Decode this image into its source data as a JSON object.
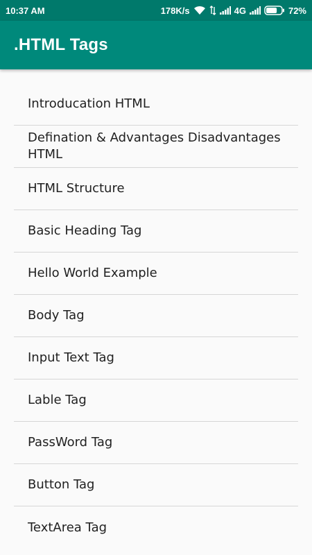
{
  "status_bar": {
    "time": "10:37 AM",
    "network_speed": "178K/s",
    "network_type": "4G",
    "battery": "72%",
    "battery_level": 0.72,
    "icons": [
      "wifi-icon",
      "data-arrows-icon",
      "signal-icon",
      "signal-icon",
      "battery-icon"
    ]
  },
  "app_bar": {
    "title": ".HTML Tags"
  },
  "colors": {
    "status_bar": "#00796b",
    "app_bar": "#00897b",
    "background": "#fafafa",
    "divider": "#d6d6d6",
    "text": "#212121"
  },
  "list": {
    "items": [
      {
        "label": "Introducation HTML"
      },
      {
        "label": "Defination & Advantages Disadvantages HTML"
      },
      {
        "label": "HTML Structure"
      },
      {
        "label": "Basic Heading Tag"
      },
      {
        "label": "Hello World Example"
      },
      {
        "label": "Body Tag"
      },
      {
        "label": "Input Text Tag"
      },
      {
        "label": "Lable Tag"
      },
      {
        "label": "PassWord Tag"
      },
      {
        "label": "Button Tag"
      },
      {
        "label": "TextArea Tag"
      }
    ]
  }
}
